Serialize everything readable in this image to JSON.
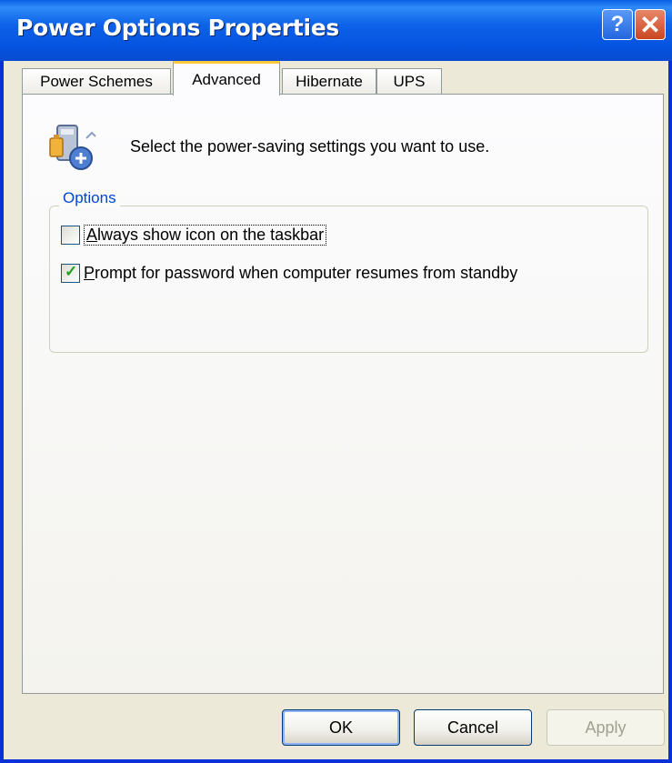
{
  "window": {
    "title": "Power Options Properties",
    "help_glyph": "?",
    "close_glyph": "✕"
  },
  "tabs": [
    {
      "label": "Power Schemes",
      "active": false
    },
    {
      "label": "Advanced",
      "active": true
    },
    {
      "label": "Hibernate",
      "active": false
    },
    {
      "label": "UPS",
      "active": false
    }
  ],
  "advanced": {
    "icon": "power-options-icon",
    "description": "Select the power-saving settings you want to use.",
    "options_group": {
      "title": "Options",
      "items": [
        {
          "label_first": "A",
          "label_rest": "lways show icon on the taskbar",
          "checked": false
        },
        {
          "label_first": "P",
          "label_rest": "rompt for password when computer resumes from standby",
          "checked": true
        }
      ]
    }
  },
  "buttons": {
    "ok": "OK",
    "cancel": "Cancel",
    "apply": "Apply"
  },
  "colors": {
    "title_bar": "#0a5ee5",
    "window_bg": "#ece9d8",
    "group_title": "#0046d5",
    "active_tab_accent": "#ffc83c",
    "close_button": "#c9461f"
  }
}
